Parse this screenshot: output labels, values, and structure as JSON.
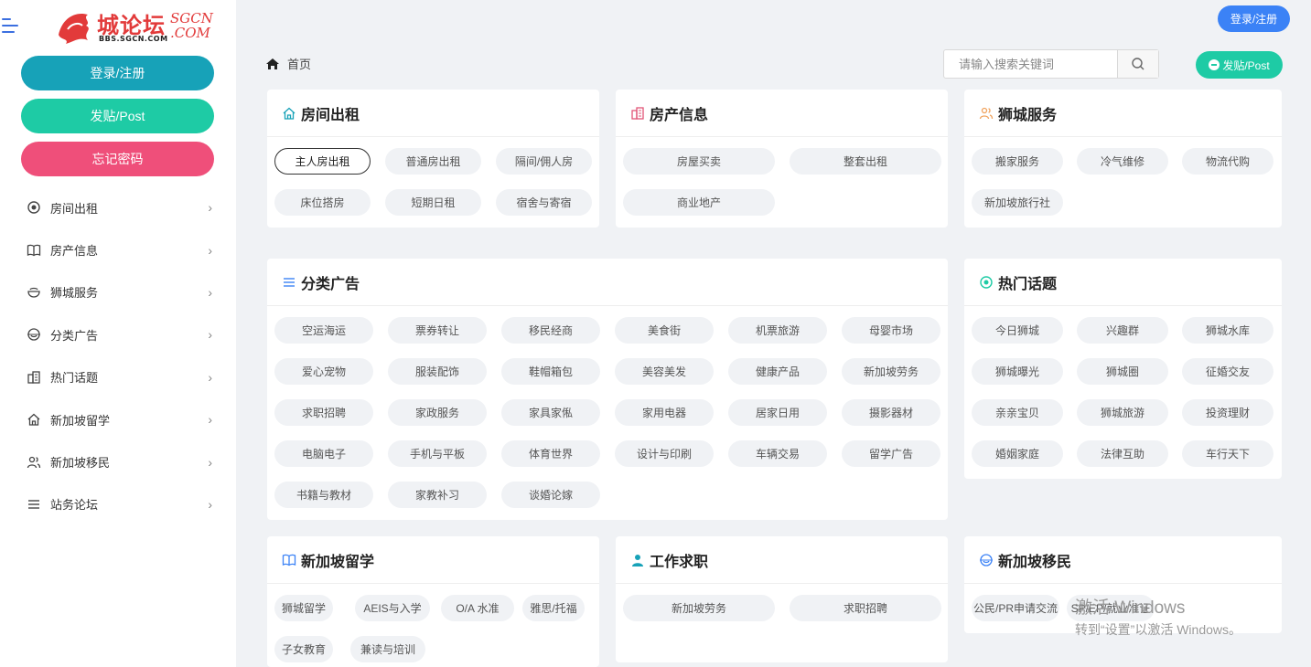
{
  "logo": {
    "brand": "城论坛",
    "sub": "BBS.SGCN.COM",
    "sgcn_line1": "SGCN",
    "sgcn_line2": ".COM"
  },
  "sidebar": {
    "login_label": "登录/注册",
    "post_label": "发贴/Post",
    "forgot_label": "忘记密码",
    "items": [
      {
        "label": "房间出租",
        "icon": "target-icon"
      },
      {
        "label": "房产信息",
        "icon": "book-icon"
      },
      {
        "label": "狮城服务",
        "icon": "bowl-icon"
      },
      {
        "label": "分类广告",
        "icon": "smile-icon"
      },
      {
        "label": "热门话题",
        "icon": "building-icon"
      },
      {
        "label": "新加坡留学",
        "icon": "home-icon"
      },
      {
        "label": "新加坡移民",
        "icon": "users-icon"
      },
      {
        "label": "站务论坛",
        "icon": "list-icon"
      }
    ]
  },
  "header": {
    "login_label": "登录/注册",
    "breadcrumb": "首页",
    "search_placeholder": "请输入搜索关键词",
    "post_label": "发贴/Post"
  },
  "cards": [
    {
      "id": "rent",
      "title": "房间出租",
      "icon": "home-icon",
      "icon_color": "#17a2b8",
      "tags": [
        "主人房出租",
        "普通房出租",
        "隔间/佣人房",
        "床位搭房",
        "短期日租",
        "宿舍与寄宿"
      ],
      "active": 0
    },
    {
      "id": "property",
      "title": "房产信息",
      "icon": "building-icon",
      "icon_color": "#e25577",
      "tags": [
        "房屋买卖",
        "整套出租",
        "商业地产"
      ]
    },
    {
      "id": "service",
      "title": "狮城服务",
      "icon": "users-icon",
      "icon_color": "#f0a35e",
      "tags": [
        "搬家服务",
        "冷气维修",
        "物流代购",
        "新加坡旅行社"
      ]
    },
    {
      "id": "ads",
      "title": "分类广告",
      "icon": "list-icon",
      "icon_color": "#3b82f6",
      "tags": [
        "空运海运",
        "票券转让",
        "移民经商",
        "美食街",
        "机票旅游",
        "母婴市场",
        "爱心宠物",
        "服装配饰",
        "鞋帽箱包",
        "美容美发",
        "健康产品",
        "新加坡劳务",
        "求职招聘",
        "家政服务",
        "家具家俬",
        "家用电器",
        "居家日用",
        "摄影器材",
        "电脑电子",
        "手机与平板",
        "体育世界",
        "设计与印刷",
        "车辆交易",
        "留学广告",
        "书籍与教材",
        "家教补习",
        "谈婚论嫁"
      ]
    },
    {
      "id": "hot",
      "title": "热门话题",
      "icon": "target-icon",
      "icon_color": "#1ecba5",
      "tags": [
        "今日狮城",
        "兴趣群",
        "狮城水库",
        "狮城曝光",
        "狮城圈",
        "征婚交友",
        "亲亲宝贝",
        "狮城旅游",
        "投资理财",
        "婚姻家庭",
        "法律互助",
        "车行天下"
      ]
    },
    {
      "id": "study",
      "title": "新加坡留学",
      "icon": "book-icon",
      "icon_color": "#3b82f6",
      "tags": [
        "狮城留学",
        "AEIS与入学",
        "O/A 水准",
        "雅思/托福",
        "子女教育",
        "兼读与培训"
      ]
    },
    {
      "id": "job",
      "title": "工作求职",
      "icon": "person-icon",
      "icon_color": "#17a2b8",
      "tags": [
        "新加坡劳务",
        "求职招聘"
      ]
    },
    {
      "id": "immig",
      "title": "新加坡移民",
      "icon": "smile-icon",
      "icon_color": "#3b82f6",
      "tags": [
        "公民/PR申请交流",
        "SP/EP/就业准证"
      ]
    }
  ],
  "watermark": {
    "line1": "激活 Windows",
    "line2": "转到“设置”以激活 Windows。"
  }
}
